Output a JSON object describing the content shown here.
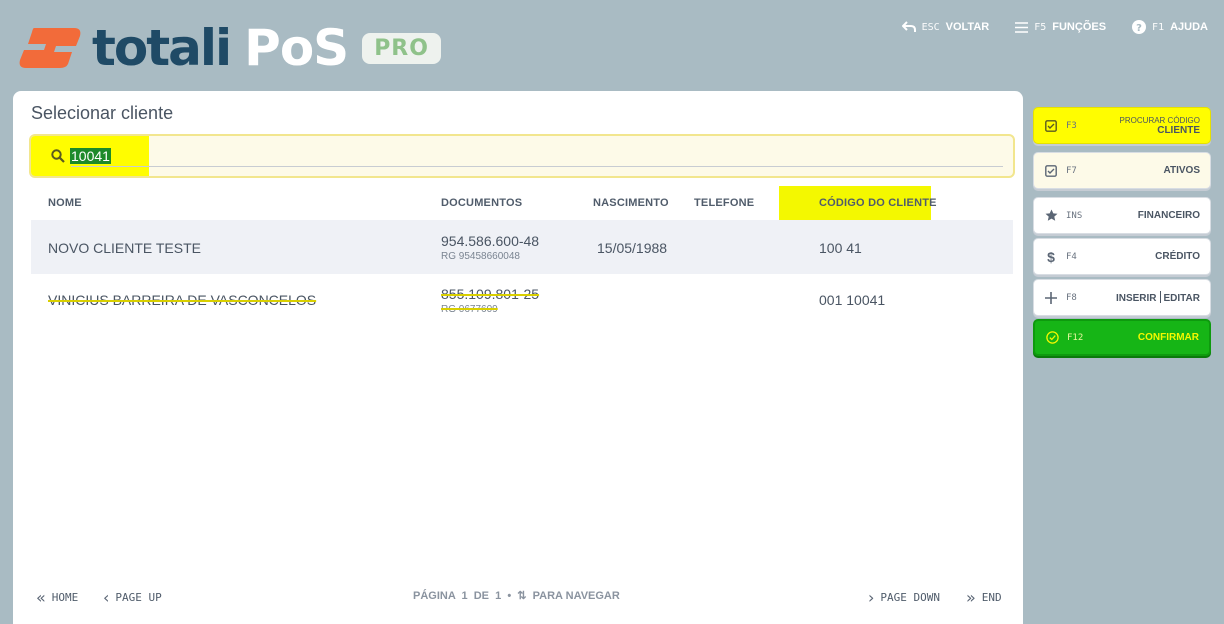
{
  "header": {
    "brand_main": "totali",
    "brand_second": "PoS",
    "brand_badge": "PRO",
    "nav": [
      {
        "key": "ESC",
        "label": "VOLTAR",
        "icon": "back-arrow-icon"
      },
      {
        "key": "F5",
        "label": "FUNÇÕES",
        "icon": "menu-icon"
      },
      {
        "key": "F1",
        "label": "AJUDA",
        "icon": "help-icon"
      }
    ]
  },
  "main": {
    "title": "Selecionar cliente",
    "search": {
      "value": "10041",
      "icon": "search-icon"
    },
    "columns": [
      "NOME",
      "DOCUMENTOS",
      "NASCIMENTO",
      "TELEFONE",
      "CÓDIGO DO CLIENTE"
    ],
    "rows": [
      {
        "nome": "NOVO CLIENTE TESTE",
        "doc": "954.586.600-48",
        "rg": "RG 95458660048",
        "nascimento": "15/05/1988",
        "telefone": "",
        "codigo": "100 41"
      },
      {
        "nome": "VINICIUS BARREIRA DE VASCONCELOS",
        "doc": "855.109.801-25",
        "rg": "RG 0677609",
        "nascimento": "",
        "telefone": "",
        "codigo": "001 10041"
      }
    ],
    "footer": {
      "home": "HOME",
      "page_up": "PAGE UP",
      "page_info": "PÁGINA  1  DE  1  •  ⇅  PARA NAVEGAR",
      "page_down": "PAGE DOWN",
      "end": "END"
    }
  },
  "sidebar": {
    "procurar": {
      "key": "F3",
      "label_small": "PROCURAR CÓDIGO",
      "label": "CLIENTE"
    },
    "ativos": {
      "key": "F7",
      "label": "ATIVOS"
    },
    "financeiro": {
      "key": "INS",
      "label": "FINANCEIRO"
    },
    "credito": {
      "key": "F4",
      "label": "CRÉDITO"
    },
    "inserir": {
      "key": "F8",
      "label_a": "INSERIR",
      "label_b": "EDITAR"
    },
    "confirmar": {
      "key": "F12",
      "label": "CONFIRMAR"
    }
  },
  "colors": {
    "bg": "#a9bbc3",
    "brand_orange": "#f26b3a",
    "brand_navy": "#1f4a66",
    "highlight": "#fffd00",
    "confirm_green": "#16b516"
  }
}
